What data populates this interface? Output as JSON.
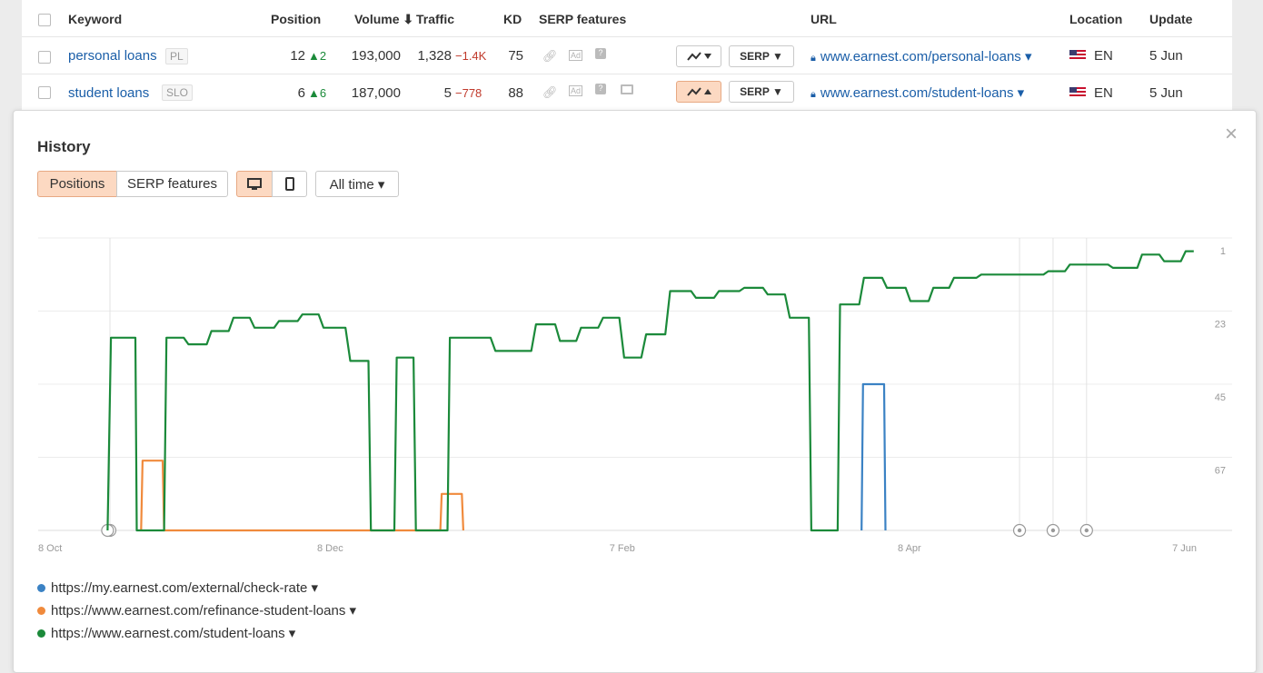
{
  "table": {
    "headers": {
      "keyword": "Keyword",
      "position": "Position",
      "volume": "Volume ⬇",
      "traffic": "Traffic",
      "kd": "KD",
      "serp_features": "SERP features",
      "url": "URL",
      "location": "Location",
      "update": "Update"
    },
    "rows": [
      {
        "keyword": "personal loans",
        "tag": "PL",
        "position": "12",
        "position_change": "▲2",
        "volume": "193,000",
        "traffic": "1,328",
        "traffic_change": "−1.4K",
        "kd": "75",
        "serp_button": "SERP ▼",
        "url": "www.earnest.com/personal-loans ▾",
        "location": "EN",
        "update": "5 Jun",
        "chart_active": false
      },
      {
        "keyword": "student loans",
        "tag": "SLO",
        "position": "6",
        "position_change": "▲6",
        "volume": "187,000",
        "traffic": "5",
        "traffic_change": "−778",
        "kd": "88",
        "serp_button": "SERP ▼",
        "url": "www.earnest.com/student-loans ▾",
        "location": "EN",
        "update": "5 Jun",
        "chart_active": true
      }
    ]
  },
  "history": {
    "title": "History",
    "tabs": [
      "Positions",
      "SERP features"
    ],
    "active_tab": "Positions",
    "time_range": "All time ▾",
    "close": "×"
  },
  "colors": {
    "accent_bg": "#fcd9c2",
    "link": "#1a5ea8",
    "series_blue": "#3b82c4",
    "series_orange": "#f08a3c",
    "series_green": "#1b8a3a"
  },
  "chart_data": {
    "type": "line",
    "y_inverted": true,
    "yticks": [
      1,
      23,
      45,
      67
    ],
    "ylim": [
      1,
      89
    ],
    "xtick_labels": [
      "8 Oct",
      "8 Dec",
      "7 Feb",
      "8 Apr",
      "7 Jun"
    ],
    "xlim_days": [
      0,
      242
    ],
    "x_unit": "days since 8 Oct",
    "annotation_days": [
      15,
      205,
      212,
      219
    ],
    "series": [
      {
        "name": "https://my.earnest.com/external/check-rate ▾",
        "color": "#3b82c4",
        "points": [
          [
            172,
            89
          ],
          [
            172.3,
            45
          ],
          [
            176.7,
            45
          ],
          [
            177,
            89
          ]
        ]
      },
      {
        "name": "https://www.earnest.com/refinance-student-loans ▾",
        "color": "#f08a3c",
        "points": [
          [
            21.5,
            89
          ],
          [
            21.8,
            68
          ],
          [
            26,
            68
          ],
          [
            26.3,
            89
          ],
          [
            84,
            89
          ],
          [
            84.3,
            78
          ],
          [
            88.5,
            78
          ],
          [
            88.8,
            89
          ]
        ]
      },
      {
        "name": "https://www.earnest.com/student-loans ▾",
        "color": "#1b8a3a",
        "points": [
          [
            14.5,
            89
          ],
          [
            15.2,
            31
          ],
          [
            20.3,
            31
          ],
          [
            20.6,
            89
          ],
          [
            26.3,
            89
          ],
          [
            26.8,
            31
          ],
          [
            30.4,
            31
          ],
          [
            31.4,
            33
          ],
          [
            35.2,
            33
          ],
          [
            36.2,
            29
          ],
          [
            39.8,
            29
          ],
          [
            40.8,
            25
          ],
          [
            44.2,
            25
          ],
          [
            45.2,
            28
          ],
          [
            49.3,
            28
          ],
          [
            50.3,
            26
          ],
          [
            54.2,
            26
          ],
          [
            55.2,
            24
          ],
          [
            58.6,
            24
          ],
          [
            59.6,
            28
          ],
          [
            64.2,
            28
          ],
          [
            65.2,
            38
          ],
          [
            69,
            38
          ],
          [
            69.5,
            89
          ],
          [
            74.4,
            89
          ],
          [
            74.9,
            37
          ],
          [
            78.4,
            37
          ],
          [
            78.9,
            89
          ],
          [
            85.5,
            89
          ],
          [
            86,
            31
          ],
          [
            94.5,
            31
          ],
          [
            95.5,
            35
          ],
          [
            103,
            35
          ],
          [
            104,
            27
          ],
          [
            108,
            27
          ],
          [
            109,
            32
          ],
          [
            112.4,
            32
          ],
          [
            113.4,
            28
          ],
          [
            117,
            28
          ],
          [
            118,
            25
          ],
          [
            121.4,
            25
          ],
          [
            122.4,
            37
          ],
          [
            126,
            37
          ],
          [
            127,
            30
          ],
          [
            131,
            30
          ],
          [
            132,
            17
          ],
          [
            136.4,
            17
          ],
          [
            137.4,
            19
          ],
          [
            141.2,
            19
          ],
          [
            142.2,
            17
          ],
          [
            146.5,
            17
          ],
          [
            147.5,
            16
          ],
          [
            151.4,
            16
          ],
          [
            152.4,
            18
          ],
          [
            156,
            18
          ],
          [
            157,
            25
          ],
          [
            161,
            25
          ],
          [
            161.5,
            89
          ],
          [
            167,
            89
          ],
          [
            167.5,
            21
          ],
          [
            171.5,
            21
          ],
          [
            172.5,
            13
          ],
          [
            176.3,
            13
          ],
          [
            177.3,
            16
          ],
          [
            181.2,
            16
          ],
          [
            182.2,
            20
          ],
          [
            186,
            20
          ],
          [
            187,
            16
          ],
          [
            190.3,
            16
          ],
          [
            191.3,
            13
          ],
          [
            196,
            13
          ],
          [
            197,
            12
          ],
          [
            210,
            12
          ],
          [
            211,
            11
          ],
          [
            214.5,
            11
          ],
          [
            215.5,
            9
          ],
          [
            223.5,
            9
          ],
          [
            224.5,
            10
          ],
          [
            229.6,
            10
          ],
          [
            230.6,
            6
          ],
          [
            234.2,
            6
          ],
          [
            235.2,
            8
          ],
          [
            238.7,
            8
          ],
          [
            239.7,
            5
          ],
          [
            241.4,
            5
          ]
        ]
      }
    ]
  }
}
